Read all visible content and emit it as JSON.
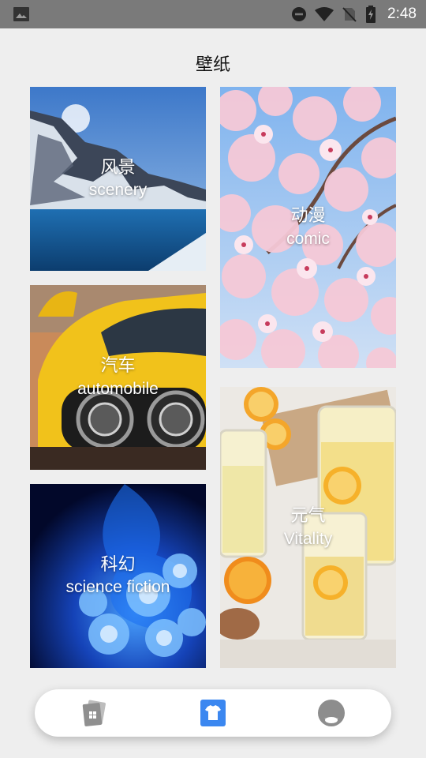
{
  "status_bar": {
    "time": "2:48",
    "icons": [
      "gallery-icon",
      "do-not-disturb-icon",
      "wifi-icon",
      "no-sim-icon",
      "battery-charging-icon"
    ]
  },
  "page": {
    "title": "壁纸"
  },
  "categories": [
    {
      "id": "scenery",
      "label_zh": "风景",
      "label_en": "scenery"
    },
    {
      "id": "comic",
      "label_zh": "动漫",
      "label_en": "comic"
    },
    {
      "id": "automobile",
      "label_zh": "汽车",
      "label_en": "automobile"
    },
    {
      "id": "vitality",
      "label_zh": "元气",
      "label_en": "Vitality"
    },
    {
      "id": "scifi",
      "label_zh": "科幻",
      "label_en": "science fiction"
    }
  ],
  "bottom_nav": {
    "items": [
      {
        "icon": "wallpaper-cards-icon",
        "active": false
      },
      {
        "icon": "tshirt-icon",
        "active": true
      },
      {
        "icon": "profile-icon",
        "active": false
      }
    ],
    "accent_color": "#3b87f0"
  }
}
